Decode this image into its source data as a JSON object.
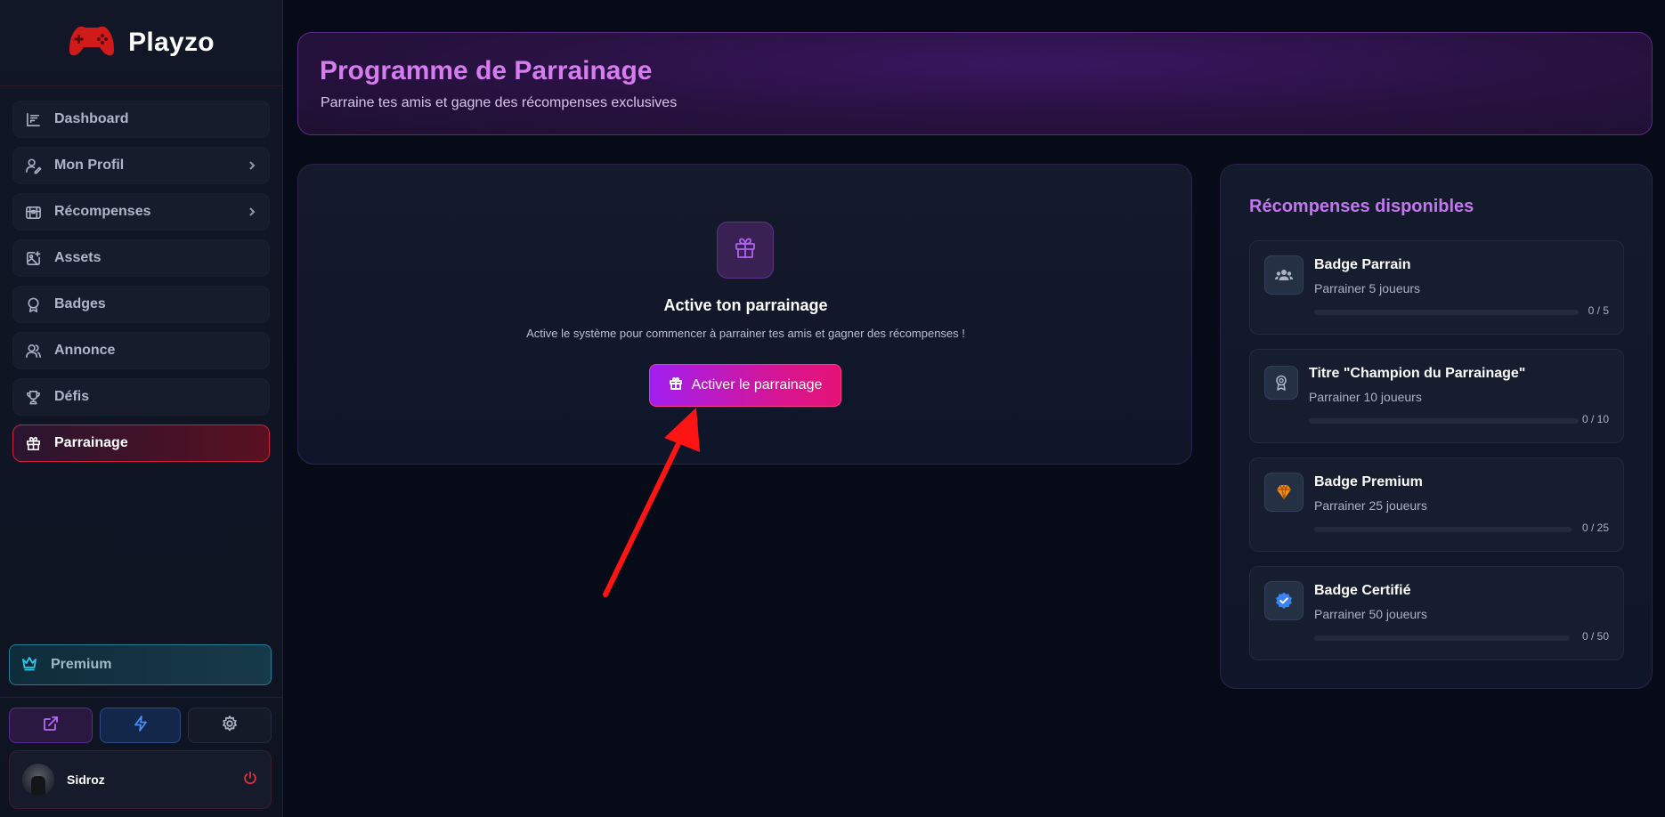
{
  "app": {
    "name": "Playzo"
  },
  "sidebar": {
    "items": [
      {
        "label": "Dashboard",
        "icon": "chart-icon",
        "chevron": false,
        "active": false
      },
      {
        "label": "Mon Profil",
        "icon": "user-edit-icon",
        "chevron": true,
        "active": false
      },
      {
        "label": "Récompenses",
        "icon": "chest-icon",
        "chevron": true,
        "active": false
      },
      {
        "label": "Assets",
        "icon": "image-plus-icon",
        "chevron": false,
        "active": false
      },
      {
        "label": "Badges",
        "icon": "award-icon",
        "chevron": false,
        "active": false
      },
      {
        "label": "Annonce",
        "icon": "users-icon",
        "chevron": false,
        "active": false
      },
      {
        "label": "Défis",
        "icon": "trophy-icon",
        "chevron": false,
        "active": false
      },
      {
        "label": "Parrainage",
        "icon": "gift-icon",
        "chevron": false,
        "active": true
      }
    ],
    "premium_label": "Premium",
    "quick_actions": [
      "external-link-icon",
      "lightning-icon",
      "gear-icon"
    ],
    "user": {
      "name": "Sidroz"
    }
  },
  "header": {
    "title": "Programme de Parrainage",
    "subtitle": "Parraine tes amis et gagne des récompenses exclusives"
  },
  "activate": {
    "title": "Active ton parrainage",
    "description": "Active le système pour commencer à parrainer tes amis et gagner des récompenses !",
    "button_label": "Activer le parrainage"
  },
  "rewards": {
    "title": "Récompenses disponibles",
    "items": [
      {
        "name": "Badge Parrain",
        "requirement": "Parrainer 5 joueurs",
        "progress": "0 / 5",
        "icon": "users-icon"
      },
      {
        "name": "Titre \"Champion du Parrainage\"",
        "requirement": "Parrainer 10 joueurs",
        "progress": "0 / 10",
        "icon": "award-icon"
      },
      {
        "name": "Badge Premium",
        "requirement": "Parrainer 25 joueurs",
        "progress": "0 / 25",
        "icon": "diamond-icon"
      },
      {
        "name": "Badge Certifié",
        "requirement": "Parrainer 50 joueurs",
        "progress": "0 / 50",
        "icon": "verified-icon"
      }
    ]
  },
  "colors": {
    "accent_purple": "#c277ef",
    "accent_pink": "#e51275",
    "active_red": "#d0203f",
    "premium_cyan": "#2fc6e8"
  }
}
